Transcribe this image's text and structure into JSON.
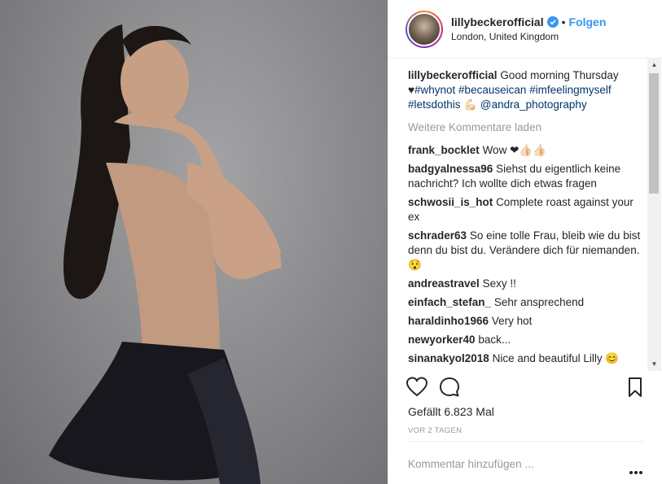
{
  "post": {
    "username": "lillybeckerofficial",
    "follow_label": "Folgen",
    "separator": "•",
    "location": "London, United Kingdom",
    "caption_text": "Good morning Thursday",
    "caption_heart": "♥",
    "caption_hashtags": "#whynot #becauseican",
    "caption_tag1": "#imfeelingmyself",
    "caption_tag2": "#letsdothis",
    "caption_emoji": "💪🏻",
    "caption_mention": "@andra_photography",
    "load_more": "Weitere Kommentare laden",
    "likes": "Gefällt 6.823 Mal",
    "time": "VOR 2 TAGEN",
    "add_comment_placeholder": "Kommentar hinzufügen ..."
  },
  "comments": [
    {
      "user": "frank_bocklet",
      "text": "Wow ❤👍🏻👍🏻"
    },
    {
      "user": "badgyalnessa96",
      "text": "Siehst du eigentlich keine nachricht? Ich wollte dich etwas fragen"
    },
    {
      "user": "schwosii_is_hot",
      "text": "Complete roast against your ex"
    },
    {
      "user": "schrader63",
      "text": "So eine tolle Frau, bleib wie du bist denn du bist du. Verändere dich für niemanden. 😯"
    },
    {
      "user": "andreastravel",
      "text": "Sexy !!"
    },
    {
      "user": "einfach_stefan_",
      "text": "Sehr ansprechend"
    },
    {
      "user": "haraldinho1966",
      "text": "Very hot"
    },
    {
      "user": "newyorker40",
      "text": "back..."
    },
    {
      "user": "sinanakyol2018",
      "text": "Nice and beautiful Lilly 😊"
    }
  ],
  "icons": {
    "verified": "verified-badge-icon",
    "like": "heart-outline-icon",
    "comment": "comment-bubble-icon",
    "save": "bookmark-icon",
    "more": "more-options-icon"
  },
  "colors": {
    "accent": "#3897f0",
    "muted": "#999999",
    "text": "#262626"
  }
}
